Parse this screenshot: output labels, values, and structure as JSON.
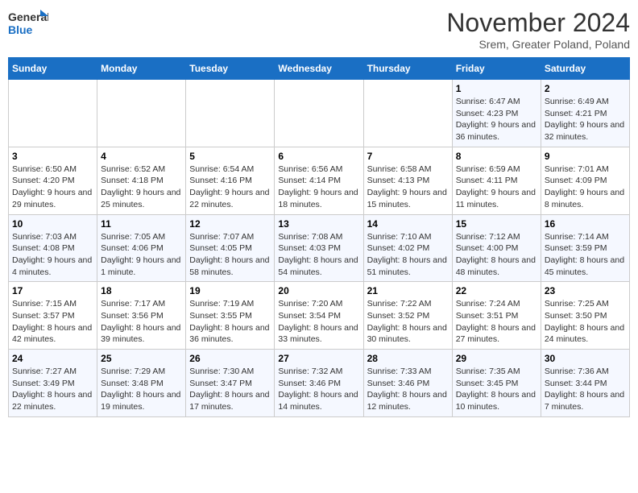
{
  "logo": {
    "text_general": "General",
    "text_blue": "Blue"
  },
  "title": "November 2024",
  "location": "Srem, Greater Poland, Poland",
  "days_of_week": [
    "Sunday",
    "Monday",
    "Tuesday",
    "Wednesday",
    "Thursday",
    "Friday",
    "Saturday"
  ],
  "weeks": [
    [
      {
        "day": "",
        "info": ""
      },
      {
        "day": "",
        "info": ""
      },
      {
        "day": "",
        "info": ""
      },
      {
        "day": "",
        "info": ""
      },
      {
        "day": "",
        "info": ""
      },
      {
        "day": "1",
        "info": "Sunrise: 6:47 AM\nSunset: 4:23 PM\nDaylight: 9 hours and 36 minutes."
      },
      {
        "day": "2",
        "info": "Sunrise: 6:49 AM\nSunset: 4:21 PM\nDaylight: 9 hours and 32 minutes."
      }
    ],
    [
      {
        "day": "3",
        "info": "Sunrise: 6:50 AM\nSunset: 4:20 PM\nDaylight: 9 hours and 29 minutes."
      },
      {
        "day": "4",
        "info": "Sunrise: 6:52 AM\nSunset: 4:18 PM\nDaylight: 9 hours and 25 minutes."
      },
      {
        "day": "5",
        "info": "Sunrise: 6:54 AM\nSunset: 4:16 PM\nDaylight: 9 hours and 22 minutes."
      },
      {
        "day": "6",
        "info": "Sunrise: 6:56 AM\nSunset: 4:14 PM\nDaylight: 9 hours and 18 minutes."
      },
      {
        "day": "7",
        "info": "Sunrise: 6:58 AM\nSunset: 4:13 PM\nDaylight: 9 hours and 15 minutes."
      },
      {
        "day": "8",
        "info": "Sunrise: 6:59 AM\nSunset: 4:11 PM\nDaylight: 9 hours and 11 minutes."
      },
      {
        "day": "9",
        "info": "Sunrise: 7:01 AM\nSunset: 4:09 PM\nDaylight: 9 hours and 8 minutes."
      }
    ],
    [
      {
        "day": "10",
        "info": "Sunrise: 7:03 AM\nSunset: 4:08 PM\nDaylight: 9 hours and 4 minutes."
      },
      {
        "day": "11",
        "info": "Sunrise: 7:05 AM\nSunset: 4:06 PM\nDaylight: 9 hours and 1 minute."
      },
      {
        "day": "12",
        "info": "Sunrise: 7:07 AM\nSunset: 4:05 PM\nDaylight: 8 hours and 58 minutes."
      },
      {
        "day": "13",
        "info": "Sunrise: 7:08 AM\nSunset: 4:03 PM\nDaylight: 8 hours and 54 minutes."
      },
      {
        "day": "14",
        "info": "Sunrise: 7:10 AM\nSunset: 4:02 PM\nDaylight: 8 hours and 51 minutes."
      },
      {
        "day": "15",
        "info": "Sunrise: 7:12 AM\nSunset: 4:00 PM\nDaylight: 8 hours and 48 minutes."
      },
      {
        "day": "16",
        "info": "Sunrise: 7:14 AM\nSunset: 3:59 PM\nDaylight: 8 hours and 45 minutes."
      }
    ],
    [
      {
        "day": "17",
        "info": "Sunrise: 7:15 AM\nSunset: 3:57 PM\nDaylight: 8 hours and 42 minutes."
      },
      {
        "day": "18",
        "info": "Sunrise: 7:17 AM\nSunset: 3:56 PM\nDaylight: 8 hours and 39 minutes."
      },
      {
        "day": "19",
        "info": "Sunrise: 7:19 AM\nSunset: 3:55 PM\nDaylight: 8 hours and 36 minutes."
      },
      {
        "day": "20",
        "info": "Sunrise: 7:20 AM\nSunset: 3:54 PM\nDaylight: 8 hours and 33 minutes."
      },
      {
        "day": "21",
        "info": "Sunrise: 7:22 AM\nSunset: 3:52 PM\nDaylight: 8 hours and 30 minutes."
      },
      {
        "day": "22",
        "info": "Sunrise: 7:24 AM\nSunset: 3:51 PM\nDaylight: 8 hours and 27 minutes."
      },
      {
        "day": "23",
        "info": "Sunrise: 7:25 AM\nSunset: 3:50 PM\nDaylight: 8 hours and 24 minutes."
      }
    ],
    [
      {
        "day": "24",
        "info": "Sunrise: 7:27 AM\nSunset: 3:49 PM\nDaylight: 8 hours and 22 minutes."
      },
      {
        "day": "25",
        "info": "Sunrise: 7:29 AM\nSunset: 3:48 PM\nDaylight: 8 hours and 19 minutes."
      },
      {
        "day": "26",
        "info": "Sunrise: 7:30 AM\nSunset: 3:47 PM\nDaylight: 8 hours and 17 minutes."
      },
      {
        "day": "27",
        "info": "Sunrise: 7:32 AM\nSunset: 3:46 PM\nDaylight: 8 hours and 14 minutes."
      },
      {
        "day": "28",
        "info": "Sunrise: 7:33 AM\nSunset: 3:46 PM\nDaylight: 8 hours and 12 minutes."
      },
      {
        "day": "29",
        "info": "Sunrise: 7:35 AM\nSunset: 3:45 PM\nDaylight: 8 hours and 10 minutes."
      },
      {
        "day": "30",
        "info": "Sunrise: 7:36 AM\nSunset: 3:44 PM\nDaylight: 8 hours and 7 minutes."
      }
    ]
  ]
}
